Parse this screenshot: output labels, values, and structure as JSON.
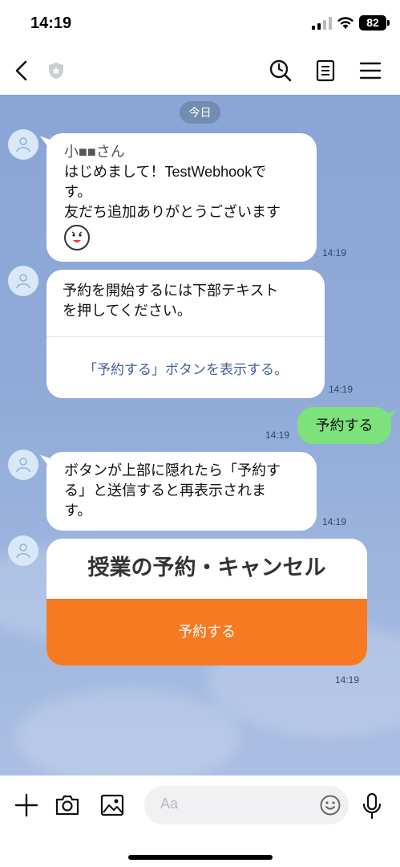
{
  "status_bar": {
    "time": "14:19",
    "battery": "82"
  },
  "header": {
    "title": ""
  },
  "chat": {
    "date_label": "今日",
    "messages": [
      {
        "lines": [
          "小■■さん",
          "はじめまして！TestWebhookで",
          "す。",
          "友だち追加ありがとうございます"
        ],
        "time": "14:19"
      },
      {
        "lines": [
          "予約を開始するには下部テキスト",
          "を押してください。"
        ],
        "action": "「予約する」ボタンを表示する。",
        "time": "14:19"
      },
      {
        "text": "予約する",
        "time": "14:19"
      },
      {
        "lines": [
          "ボタンが上部に隠れたら「予約す",
          "る」と送信すると再表示されま",
          "す。"
        ],
        "time": "14:19"
      },
      {
        "title": "授業の予約・キャンセル",
        "button": "予約する",
        "time": "14:19"
      }
    ]
  },
  "input": {
    "placeholder": "Aa"
  },
  "colors": {
    "chat_bg": "#8aa5d6",
    "sent_bubble": "#7ee27c",
    "card_button": "#f77a22"
  }
}
